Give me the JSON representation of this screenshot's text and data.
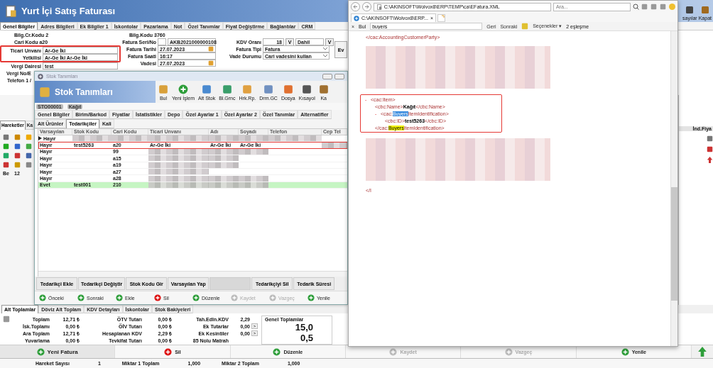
{
  "invoice_window": {
    "title": "Yurt İçi Satış Faturası",
    "toolbar": [
      {
        "label": "sayılar"
      },
      {
        "label": "Kapat"
      }
    ],
    "tabs": [
      {
        "label": "Genel Bilgiler",
        "selected": true
      },
      {
        "label": "Adres Bilgileri",
        "selected": false
      },
      {
        "label": "Ek Bilgiler 1",
        "selected": false
      },
      {
        "label": "İskontolar",
        "selected": false
      },
      {
        "label": "Pazarlama",
        "selected": false
      },
      {
        "label": "Not",
        "selected": false
      },
      {
        "label": "Özel Tanımlar",
        "selected": false
      },
      {
        "label": "Fiyat Değiştirme",
        "selected": false
      },
      {
        "label": "Bağlantılar",
        "selected": false
      },
      {
        "label": "CRM",
        "selected": false
      }
    ],
    "form_left": [
      {
        "annotated": false,
        "rows": [
          {
            "kind": "info",
            "label": "Bilg.Cr.Kodu 2"
          },
          {
            "kind": "info",
            "label": "Cari Kodu a20"
          }
        ]
      },
      {
        "annotated": true,
        "rows": [
          {
            "kind": "field",
            "label": "Ticari Unvanı",
            "value": "Ar-Ge İki"
          },
          {
            "kind": "field",
            "label": "Yetkilisi",
            "value": "Ar-Ge İki Ar-Ge İki"
          }
        ]
      },
      {
        "annotated": false,
        "rows": [
          {
            "kind": "field",
            "label": "Vergi Dairesi",
            "value": "test"
          },
          {
            "kind": "label",
            "label": "Vergi No/E"
          },
          {
            "kind": "label",
            "label": "Telefon 1 /"
          }
        ]
      }
    ],
    "form_middle": [
      {
        "kind": "info",
        "label": "Bilg.Kodu 3760"
      },
      {
        "kind": "serial",
        "label": "Fatura Seri/No",
        "value": "AKB2021000000108"
      },
      {
        "kind": "date",
        "label": "Fatura Tarihi",
        "value": "27.07.2023"
      },
      {
        "kind": "field",
        "label": "Fatura Saati",
        "value": "16:17"
      },
      {
        "kind": "date",
        "label": "Vadesi",
        "value": "27.07.2023"
      }
    ],
    "form_right": [
      {
        "kind": "vat",
        "label": "KDV Oranı",
        "value": "18",
        "unit": "V",
        "select": "Dahil",
        "button": "V"
      },
      {
        "kind": "select",
        "label": "Fatura Tipi",
        "value": "Fatura"
      },
      {
        "kind": "select",
        "label": "Vade Durumu",
        "value": "Cari vadesini kullan"
      }
    ],
    "side_button": "Ev",
    "lower_tabs": [
      {
        "label": "Hareketler",
        "selected": true
      },
      {
        "label": "Ka",
        "selected": false
      }
    ],
    "grid_peek": [
      "Be",
      "12"
    ],
    "right_panel_header": "İnd.Fiya",
    "total_tabs": [
      {
        "label": "Alt Toplamlar",
        "selected": true
      },
      {
        "label": "Döviz Alt Toplam",
        "selected": false
      },
      {
        "label": "KDV Detayları",
        "selected": false
      },
      {
        "label": "İskontolar",
        "selected": false
      },
      {
        "label": "Stok Bakiyeleri",
        "selected": false
      }
    ],
    "totals": [
      [
        {
          "label": "Toplam",
          "value": "12,71 ₺"
        },
        {
          "label": "İsk.Toplamı",
          "value": "0,00 ₺"
        },
        {
          "label": "Ara Toplam",
          "value": "12,71 ₺"
        },
        {
          "label": "Yuvarlama",
          "value": "0,00 ₺"
        }
      ],
      [
        {
          "label": "ÖTV Tutarı",
          "value": "0,00 ₺"
        },
        {
          "label": "ÖİV Tutarı",
          "value": "0,00 ₺"
        },
        {
          "label": "Hesaplanan KDV",
          "value": "2,29 ₺"
        },
        {
          "label": "Tevkifat Tutarı",
          "value": "0,00 ₺"
        }
      ],
      [
        {
          "label": "Tah.Edln.KDV",
          "value": "2,29"
        },
        {
          "label": "Ek Tutarlar",
          "value": "0,00",
          "more": ">"
        },
        {
          "label": "Ek Kesintiler",
          "value": "0,00",
          "more": ">"
        },
        {
          "label": "85 Nolu Matrah"
        }
      ]
    ],
    "grand_totals": {
      "title": "Genel Toplamlar",
      "values": [
        "15,0",
        "0,5"
      ]
    },
    "buttons": [
      {
        "label": "Yeni Fatura",
        "disabled": false
      },
      {
        "label": "Sil",
        "disabled": false
      },
      {
        "label": "Düzenle",
        "disabled": false
      },
      {
        "label": "Kaydet",
        "disabled": true
      },
      {
        "label": "Vazgeç",
        "disabled": true
      },
      {
        "label": "Yenile",
        "disabled": false
      }
    ],
    "status_bar": [
      {
        "label": "Hareket Sayısı",
        "value": "1"
      },
      {
        "label": "Miktar 1 Toplam",
        "value": "1,000"
      },
      {
        "label": "Miktar 2 Toplam",
        "value": "1,000"
      }
    ]
  },
  "stock_window": {
    "caption": "Stok Tanımları",
    "title": "Stok Tanımları",
    "toolbar": [
      {
        "label": "Bul"
      },
      {
        "label": "Yeni İşlem"
      },
      {
        "label": "Alt Stok"
      },
      {
        "label": "Bl.Grnc"
      },
      {
        "label": "Hrk.Rp."
      },
      {
        "label": "Drm.GC"
      },
      {
        "label": "Dosya"
      },
      {
        "label": "Kısayol"
      },
      {
        "label": "Ka"
      }
    ],
    "record_code": "STO00001",
    "record_name": "Kağıt",
    "tabs": [
      {
        "label": "Genel Bilgiler",
        "selected": false
      },
      {
        "label": "Birim/Barkod",
        "selected": false
      },
      {
        "label": "Fiyatlar",
        "selected": false
      },
      {
        "label": "İstatistikler",
        "selected": false
      },
      {
        "label": "Depo",
        "selected": false
      },
      {
        "label": "Özel Ayarlar 1",
        "selected": false
      },
      {
        "label": "Özel Ayarlar 2",
        "selected": false
      },
      {
        "label": "Özel Tanımlar",
        "selected": false
      },
      {
        "label": "Alternatifler",
        "selected": false
      },
      {
        "label": "Alt Ürünler",
        "selected": false
      },
      {
        "label": "Tedarikçiler",
        "selected": true
      },
      {
        "label": "Kali",
        "selected": false
      }
    ],
    "columns": [
      "Varsayılan",
      "Stok Kodu",
      "Cari Kodu",
      "Ticari Unvanı",
      "Adı",
      "Soyadı",
      "Telefon",
      "Cep Tel"
    ],
    "rows": [
      {
        "current": true,
        "annotated": false,
        "highlighted": false,
        "cells": [
          {
            "kind": "text",
            "text": "Hayır"
          },
          {
            "kind": "blurred"
          },
          {
            "kind": "blurred"
          },
          {
            "kind": "blurred"
          },
          {
            "kind": "blurred"
          },
          {
            "kind": "blurred"
          },
          {
            "kind": "blurred"
          },
          {
            "kind": "blank"
          }
        ]
      },
      {
        "current": false,
        "annotated": true,
        "highlighted": false,
        "cells": [
          {
            "kind": "text",
            "text": "Hayır"
          },
          {
            "kind": "text",
            "text": "test5263"
          },
          {
            "kind": "text",
            "text": "a20"
          },
          {
            "kind": "text",
            "text": "Ar-Ge İki"
          },
          {
            "kind": "text",
            "text": "Ar-Ge İki"
          },
          {
            "kind": "text",
            "text": "Ar-Ge İki"
          },
          {
            "kind": "blank"
          },
          {
            "kind": "blurred"
          }
        ]
      },
      {
        "current": false,
        "annotated": false,
        "highlighted": false,
        "cells": [
          {
            "kind": "text",
            "text": "Hayır"
          },
          {
            "kind": "blank"
          },
          {
            "kind": "text",
            "text": "99"
          },
          {
            "kind": "blurred"
          },
          {
            "kind": "blurred"
          },
          {
            "kind": "blurred"
          },
          {
            "kind": "blank"
          },
          {
            "kind": "blank"
          }
        ]
      },
      {
        "current": false,
        "annotated": false,
        "highlighted": false,
        "cells": [
          {
            "kind": "text",
            "text": "Hayır"
          },
          {
            "kind": "blank"
          },
          {
            "kind": "text",
            "text": "a15"
          },
          {
            "kind": "blurred"
          },
          {
            "kind": "blurred"
          },
          {
            "kind": "blank"
          },
          {
            "kind": "blank"
          },
          {
            "kind": "blank"
          }
        ]
      },
      {
        "current": false,
        "annotated": false,
        "highlighted": false,
        "cells": [
          {
            "kind": "text",
            "text": "Hayır"
          },
          {
            "kind": "blank"
          },
          {
            "kind": "text",
            "text": "a19"
          },
          {
            "kind": "blurred"
          },
          {
            "kind": "blurred"
          },
          {
            "kind": "blank"
          },
          {
            "kind": "blank"
          },
          {
            "kind": "blank"
          }
        ]
      },
      {
        "current": false,
        "annotated": false,
        "highlighted": false,
        "cells": [
          {
            "kind": "text",
            "text": "Hayır"
          },
          {
            "kind": "blank"
          },
          {
            "kind": "text",
            "text": "a27"
          },
          {
            "kind": "blurred"
          },
          {
            "kind": "blank"
          },
          {
            "kind": "blank"
          },
          {
            "kind": "blank"
          },
          {
            "kind": "blank"
          }
        ]
      },
      {
        "current": false,
        "annotated": false,
        "highlighted": false,
        "cells": [
          {
            "kind": "text",
            "text": "Hayır"
          },
          {
            "kind": "blank"
          },
          {
            "kind": "text",
            "text": "a28"
          },
          {
            "kind": "blurred"
          },
          {
            "kind": "blurred"
          },
          {
            "kind": "blurred"
          },
          {
            "kind": "blank"
          },
          {
            "kind": "blank"
          }
        ]
      },
      {
        "current": false,
        "annotated": false,
        "highlighted": true,
        "cells": [
          {
            "kind": "text",
            "text": "Evet"
          },
          {
            "kind": "text",
            "text": "test001"
          },
          {
            "kind": "text",
            "text": "210"
          },
          {
            "kind": "blurred"
          },
          {
            "kind": "blurred"
          },
          {
            "kind": "blurred"
          },
          {
            "kind": "blank"
          },
          {
            "kind": "blank"
          }
        ]
      }
    ],
    "supplier_buttons": [
      {
        "label": "Tedarikçi Ekle",
        "disabled": false
      },
      {
        "label": "Tedarikçi Değiştir",
        "disabled": false
      },
      {
        "label": "Stok Kodu Gir",
        "disabled": false
      },
      {
        "label": "Varsayılan Yap",
        "disabled": false
      },
      {
        "disabled": true
      },
      {
        "label": "Tedarikçiyi Sil",
        "disabled": false
      },
      {
        "label": "Tedarik Süresi",
        "disabled": false
      }
    ],
    "nav_buttons": [
      {
        "label": "Önceki",
        "disabled": false
      },
      {
        "label": "Sonraki",
        "disabled": false
      },
      {
        "label": "Ekle",
        "disabled": false
      },
      {
        "label": "Sil",
        "disabled": false
      },
      {
        "label": "Düzenle",
        "disabled": false
      },
      {
        "label": "Kaydet",
        "disabled": true
      },
      {
        "label": "Vazgeç",
        "disabled": true
      },
      {
        "label": "Yenile",
        "disabled": false
      }
    ]
  },
  "browser_window": {
    "address": "C:\\AKINSOFT\\Wolvox8\\ERP\\TEMP\\ca\\EFatura.XML",
    "search_placeholder": "Ara...",
    "tab": {
      "label": "C:\\AKINSOFT\\Wolvox8\\ERP...",
      "close": "×"
    },
    "find_bar": {
      "close": "×",
      "label": "Bul",
      "query": "buyers",
      "previous": "Geri",
      "next": "Sonraki",
      "options": "Seçenekler",
      "options_caret": "▾",
      "result": "2 eşleşme"
    },
    "xml": [
      {
        "kind": "element",
        "parts": [
          {
            "kind": "tag",
            "text": "</cac:AccountingCustomerParty>"
          }
        ]
      },
      {
        "kind": "blurred"
      },
      {
        "kind": "element",
        "annotated": true,
        "toggle": "-",
        "parts": [
          {
            "kind": "tag",
            "text": "<cac:Item>"
          }
        ],
        "children": [
          {
            "kind": "element",
            "parts": [
              {
                "kind": "tag",
                "text": "<cbc:Name>"
              },
              {
                "kind": "value",
                "text": "Kağıt"
              },
              {
                "kind": "tag",
                "text": "</cbc:Name>"
              }
            ]
          },
          {
            "kind": "element",
            "toggle": "-",
            "parts": [
              {
                "kind": "tag",
                "text": "<cac:"
              },
              {
                "kind": "current_match",
                "text": "Buyers"
              },
              {
                "kind": "tag",
                "text": "ItemIdentification>"
              }
            ],
            "children": [
              {
                "kind": "element",
                "parts": [
                  {
                    "kind": "tag",
                    "text": "<cbc:ID>"
                  },
                  {
                    "kind": "value",
                    "text": "test5263"
                  },
                  {
                    "kind": "tag",
                    "text": "</cbc:ID>"
                  }
                ]
              }
            ]
          },
          {
            "kind": "element",
            "parts": [
              {
                "kind": "tag",
                "text": "</cac:"
              },
              {
                "kind": "match",
                "text": "Buyers"
              },
              {
                "kind": "tag",
                "text": "ItemIdentification>"
              }
            ]
          }
        ]
      },
      {
        "kind": "blurred"
      },
      {
        "kind": "element",
        "parts": [
          {
            "kind": "tag",
            "text": "</I"
          }
        ]
      }
    ]
  }
}
